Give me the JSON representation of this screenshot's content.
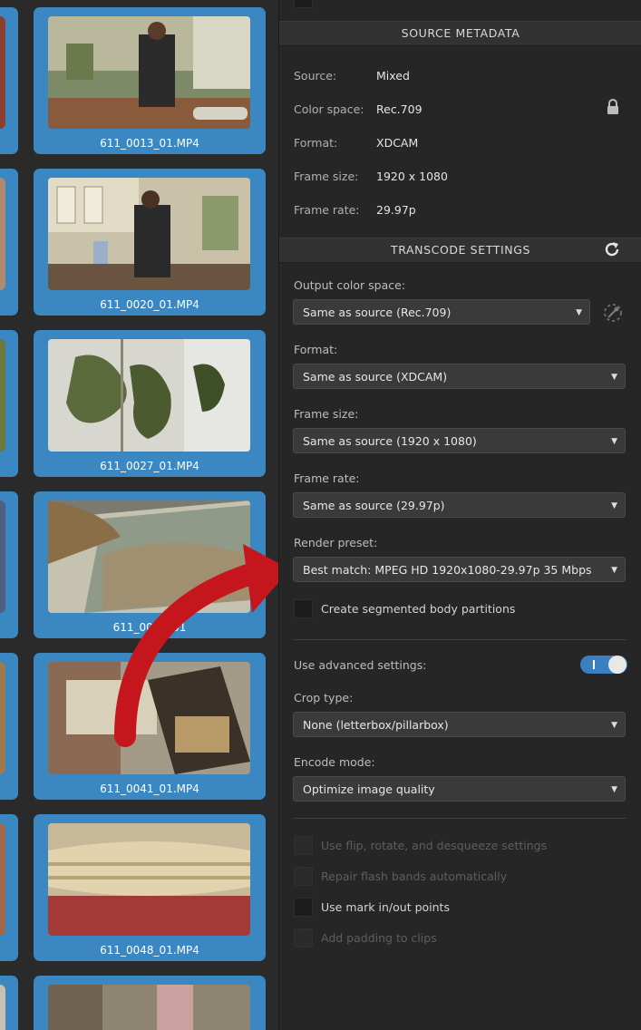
{
  "thumbnails": [
    {
      "filename": "611_0013_01.MP4"
    },
    {
      "filename": "611_0020_01.MP4"
    },
    {
      "filename": "611_0027_01.MP4"
    },
    {
      "filename": "611_0034_01"
    },
    {
      "filename": "611_0041_01.MP4"
    },
    {
      "filename": "611_0048_01.MP4"
    }
  ],
  "source_metadata": {
    "header": "SOURCE METADATA",
    "rows": [
      {
        "label": "Source:",
        "value": "Mixed"
      },
      {
        "label": "Color space:",
        "value": "Rec.709"
      },
      {
        "label": "Format:",
        "value": "XDCAM"
      },
      {
        "label": "Frame size:",
        "value": "1920 x 1080"
      },
      {
        "label": "Frame rate:",
        "value": "29.97p"
      }
    ]
  },
  "transcode": {
    "header": "TRANSCODE SETTINGS",
    "output_color_space": {
      "label": "Output color space:",
      "value": "Same as source (Rec.709)"
    },
    "format": {
      "label": "Format:",
      "value": "Same as source (XDCAM)"
    },
    "frame_size": {
      "label": "Frame size:",
      "value": "Same as source (1920 x 1080)"
    },
    "frame_rate": {
      "label": "Frame rate:",
      "value": "Same as source (29.97p)"
    },
    "render_preset": {
      "label": "Render preset:",
      "value": "Best match: MPEG HD 1920x1080-29.97p 35 Mbps"
    },
    "segmented": {
      "label": "Create segmented body partitions",
      "checked": false
    },
    "advanced": {
      "label": "Use advanced settings:",
      "on": true
    },
    "crop_type": {
      "label": "Crop type:",
      "value": "None (letterbox/pillarbox)"
    },
    "encode_mode": {
      "label": "Encode mode:",
      "value": "Optimize image quality"
    },
    "options": [
      {
        "label": "Use flip, rotate, and desqueeze settings",
        "enabled": false
      },
      {
        "label": "Repair flash bands automatically",
        "enabled": false
      },
      {
        "label": "Use mark in/out points",
        "enabled": true
      },
      {
        "label": "Add padding to clips",
        "enabled": false
      }
    ]
  },
  "colors": {
    "accent": "#3a87c2",
    "annotation_arrow": "#c4161c",
    "toggle_on": "#3a7fc0"
  },
  "icons": {
    "lock": "lock-icon",
    "reset": "reset-icon",
    "color_picker": "eyedropper-icon"
  }
}
